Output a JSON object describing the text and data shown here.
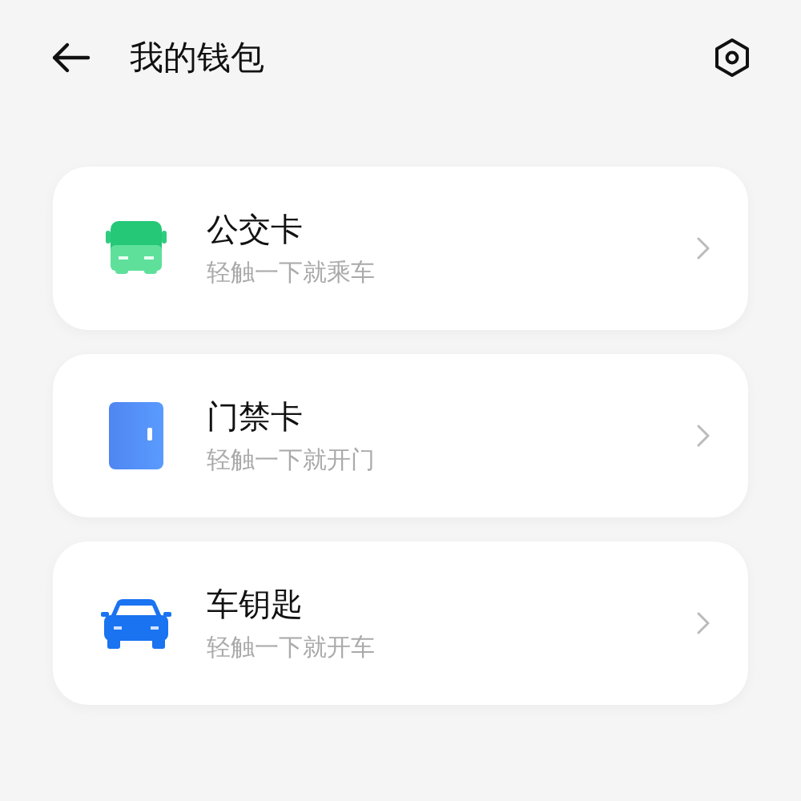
{
  "header": {
    "title": "我的钱包"
  },
  "cards": [
    {
      "kind": "bus",
      "title": "公交卡",
      "subtitle": "轻触一下就乘车"
    },
    {
      "kind": "door",
      "title": "门禁卡",
      "subtitle": "轻触一下就开门"
    },
    {
      "kind": "car",
      "title": "车钥匙",
      "subtitle": "轻触一下就开车"
    }
  ]
}
